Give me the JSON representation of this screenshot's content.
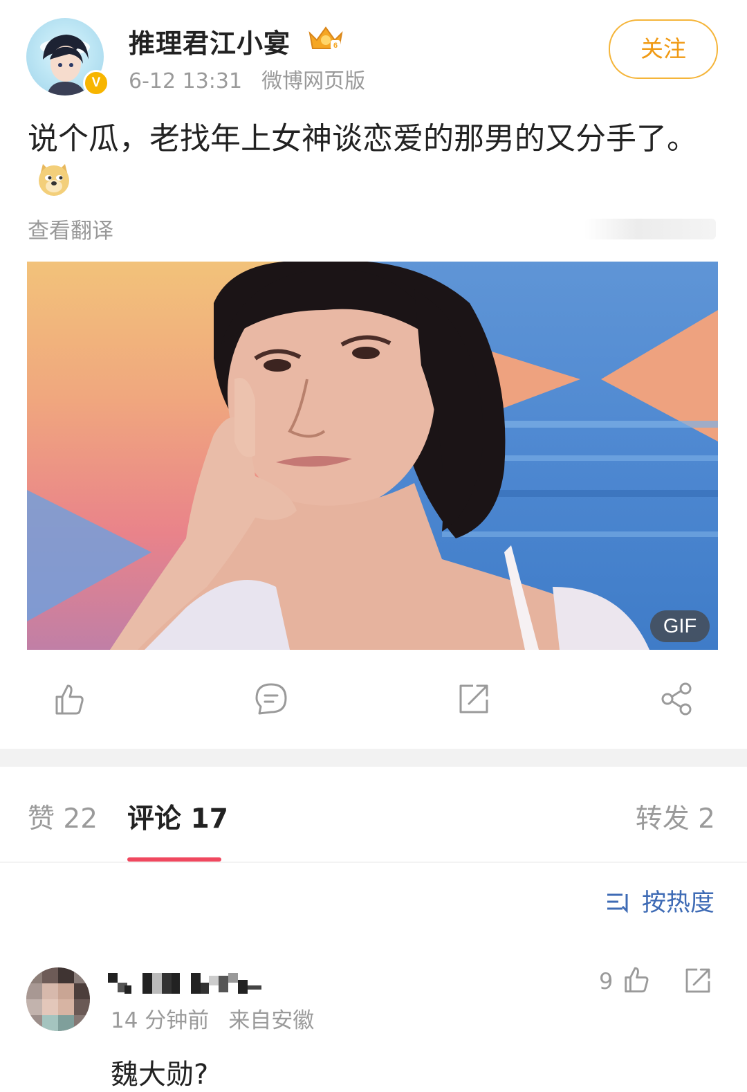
{
  "post": {
    "author": "推理君江小宴",
    "time": "6-12 13:31",
    "source": "微博网页版",
    "follow_label": "关注",
    "text": "说个瓜，老找年上女神谈恋爱的那男的又分手了。",
    "emoji": "doge-emoji",
    "translate_label": "查看翻译",
    "media_badge": "GIF"
  },
  "actions": {
    "items": [
      {
        "name": "like-icon"
      },
      {
        "name": "comment-icon"
      },
      {
        "name": "repost-icon"
      },
      {
        "name": "share-icon"
      }
    ]
  },
  "tabs": {
    "likes": "赞 22",
    "comments": "评论 17",
    "reposts": "转发 2",
    "active": "comments"
  },
  "sort": {
    "label": "按热度",
    "accent": "#3e6bb5"
  },
  "comments": [
    {
      "time": "14 分钟前",
      "location": "来自安徽",
      "likes": "9",
      "text": "魏大勋?"
    }
  ],
  "colors": {
    "follow": "#f09a14",
    "tab_underline": "#f0485f",
    "verified": "#f7b500"
  }
}
